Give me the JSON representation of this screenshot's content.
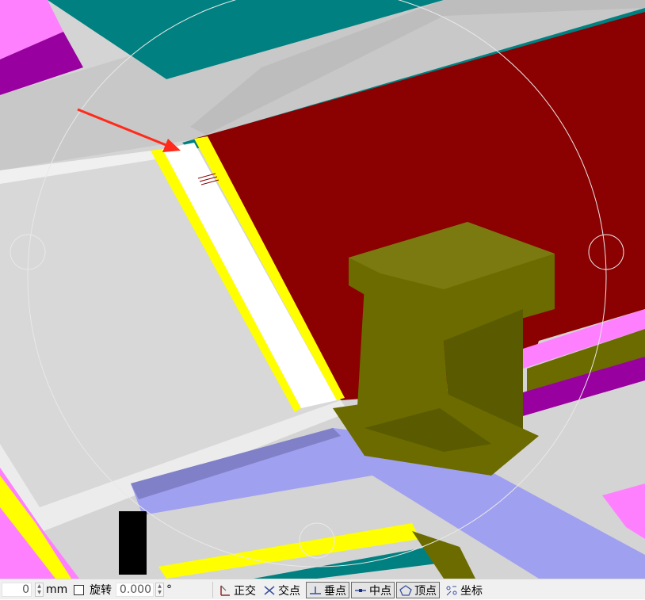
{
  "statusbar": {
    "offset_value": "0",
    "offset_unit": "mm",
    "rotate_label": "旋转",
    "rotate_checked": false,
    "angle_value": "0.000",
    "angle_unit": "°",
    "snap_tools": [
      {
        "label": "正交",
        "icon": "orthogonal-icon",
        "active": false
      },
      {
        "label": "交点",
        "icon": "intersection-icon",
        "active": false
      },
      {
        "label": "垂点",
        "icon": "perpendicular-icon",
        "active": true
      },
      {
        "label": "中点",
        "icon": "midpoint-icon",
        "active": true
      },
      {
        "label": "顶点",
        "icon": "vertex-icon",
        "active": true
      },
      {
        "label": "坐标",
        "icon": "coordinate-icon",
        "active": false
      }
    ]
  },
  "colors": {
    "beam_red": "#8b0000",
    "column_olive": "#6b6b00",
    "edge_yellow": "#ffff00",
    "teal": "#008080",
    "magenta": "#ff80ff",
    "purple": "#9900a0",
    "periwinkle": "#a0a0f0",
    "arrow_red": "#ff2a1a"
  }
}
